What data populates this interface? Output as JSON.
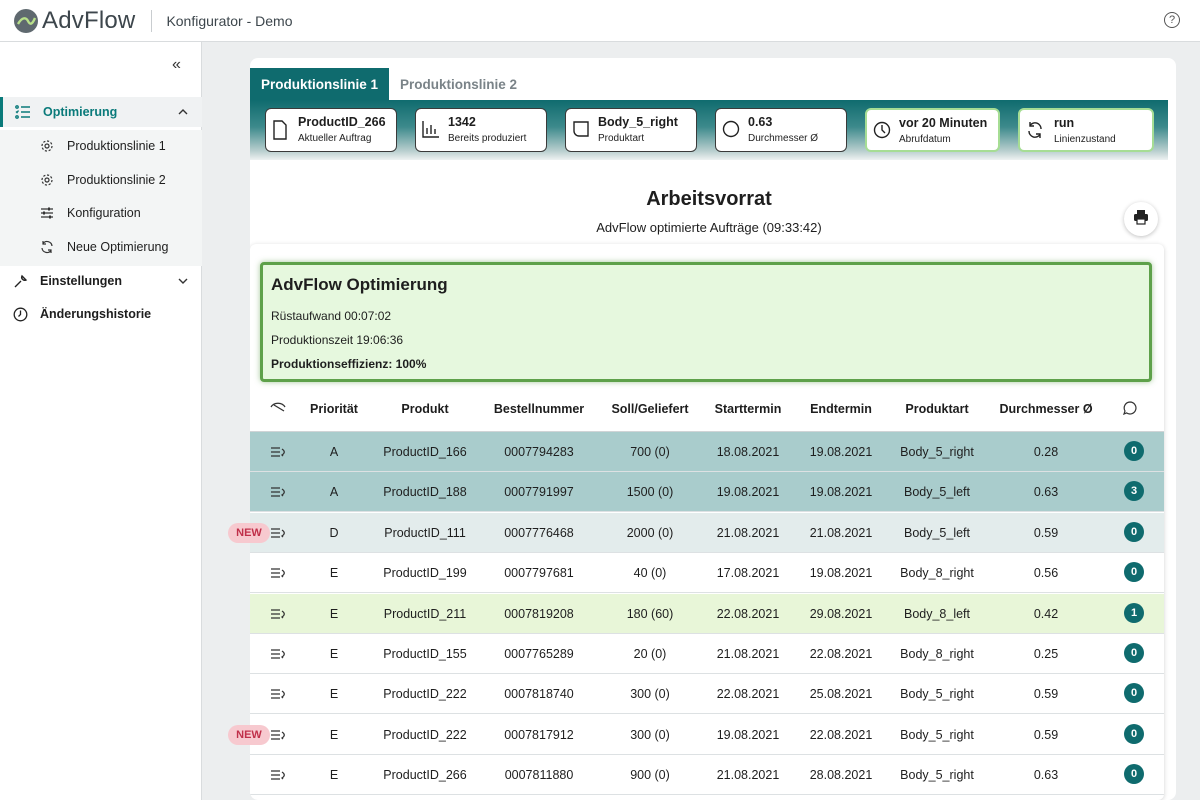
{
  "header": {
    "logo_text": "AdvFlow",
    "app_title": "Konfigurator - Demo",
    "help_label": "?"
  },
  "sidebar": {
    "collapse_label": "«",
    "items": [
      {
        "label": "Optimierung",
        "icon": "list-settings-icon"
      },
      {
        "label": "Produktionslinie 1",
        "icon": "gear-icon"
      },
      {
        "label": "Produktionslinie 2",
        "icon": "gear-icon"
      },
      {
        "label": "Konfiguration",
        "icon": "sliders-icon"
      },
      {
        "label": "Neue Optimierung",
        "icon": "refresh-icon"
      },
      {
        "label": "Einstellungen",
        "icon": "wrench-icon"
      },
      {
        "label": "Änderungshistorie",
        "icon": "clock-icon"
      }
    ]
  },
  "tabs": [
    "Produktionslinie 1",
    "Produktionslinie 2"
  ],
  "kpis": [
    {
      "value": "ProductID_266",
      "label": "Aktueller Auftrag",
      "icon": "document-icon"
    },
    {
      "value": "1342",
      "label": "Bereits produziert",
      "icon": "bar-chart-icon"
    },
    {
      "value": "Body_5_right",
      "label": "Produktart",
      "icon": "shape-icon"
    },
    {
      "value": "0.63",
      "label": "Durchmesser Ø",
      "icon": "circle-icon"
    },
    {
      "value": "vor 20 Minuten",
      "label": "Abrufdatum",
      "icon": "clock-icon"
    },
    {
      "value": "run",
      "label": "Linienzustand",
      "icon": "refresh-icon"
    }
  ],
  "main": {
    "title": "Arbeitsvorrat",
    "subtitle": "AdvFlow optimierte Aufträge (09:33:42)"
  },
  "optimization": {
    "heading": "AdvFlow Optimierung",
    "ruestaufwand": "Rüstaufwand 00:07:02",
    "produktionszeit": "Produktionszeit 19:06:36",
    "effizienz": "Produktionseffizienz: 100%"
  },
  "table": {
    "columns": [
      "Priorität",
      "Produkt",
      "Bestellnummer",
      "Soll/Geliefert",
      "Starttermin",
      "Endtermin",
      "Produktart",
      "Durchmesser Ø"
    ],
    "new_label": "NEW",
    "rows": [
      {
        "prio": "A",
        "produkt": "ProductID_166",
        "bestell": "0007794283",
        "soll": "700 (0)",
        "start": "18.08.2021",
        "end": "19.08.2021",
        "art": "Body_5_right",
        "dm": "0.28",
        "comments": "0",
        "bg": "#a9cccc",
        "new": false
      },
      {
        "prio": "A",
        "produkt": "ProductID_188",
        "bestell": "0007791997",
        "soll": "1500 (0)",
        "start": "19.08.2021",
        "end": "19.08.2021",
        "art": "Body_5_left",
        "dm": "0.63",
        "comments": "3",
        "bg": "#a9cccc",
        "new": false
      },
      {
        "prio": "D",
        "produkt": "ProductID_111",
        "bestell": "0007776468",
        "soll": "2000 (0)",
        "start": "21.08.2021",
        "end": "21.08.2021",
        "art": "Body_5_left",
        "dm": "0.59",
        "comments": "0",
        "bg": "#e3ecec",
        "new": true
      },
      {
        "prio": "E",
        "produkt": "ProductID_199",
        "bestell": "0007797681",
        "soll": "40 (0)",
        "start": "17.08.2021",
        "end": "19.08.2021",
        "art": "Body_8_right",
        "dm": "0.56",
        "comments": "0",
        "bg": "#ffffff",
        "new": false
      },
      {
        "prio": "E",
        "produkt": "ProductID_211",
        "bestell": "0007819208",
        "soll": "180 (60)",
        "start": "22.08.2021",
        "end": "29.08.2021",
        "art": "Body_8_left",
        "dm": "0.42",
        "comments": "1",
        "bg": "#e8f6d8",
        "new": false
      },
      {
        "prio": "E",
        "produkt": "ProductID_155",
        "bestell": "0007765289",
        "soll": "20 (0)",
        "start": "21.08.2021",
        "end": "22.08.2021",
        "art": "Body_8_right",
        "dm": "0.25",
        "comments": "0",
        "bg": "#ffffff",
        "new": false
      },
      {
        "prio": "E",
        "produkt": "ProductID_222",
        "bestell": "0007818740",
        "soll": "300 (0)",
        "start": "22.08.2021",
        "end": "25.08.2021",
        "art": "Body_5_right",
        "dm": "0.59",
        "comments": "0",
        "bg": "#ffffff",
        "new": false
      },
      {
        "prio": "E",
        "produkt": "ProductID_222",
        "bestell": "0007817912",
        "soll": "300 (0)",
        "start": "19.08.2021",
        "end": "22.08.2021",
        "art": "Body_5_right",
        "dm": "0.59",
        "comments": "0",
        "bg": "#ffffff",
        "new": true
      },
      {
        "prio": "E",
        "produkt": "ProductID_266",
        "bestell": "0007811880",
        "soll": "900 (0)",
        "start": "21.08.2021",
        "end": "28.08.2021",
        "art": "Body_5_right",
        "dm": "0.63",
        "comments": "0",
        "bg": "#ffffff",
        "new": false
      }
    ]
  },
  "colors": {
    "accent": "#0f6b6e",
    "green_border": "#a6dd94",
    "new_bg": "#f7c9cf"
  }
}
